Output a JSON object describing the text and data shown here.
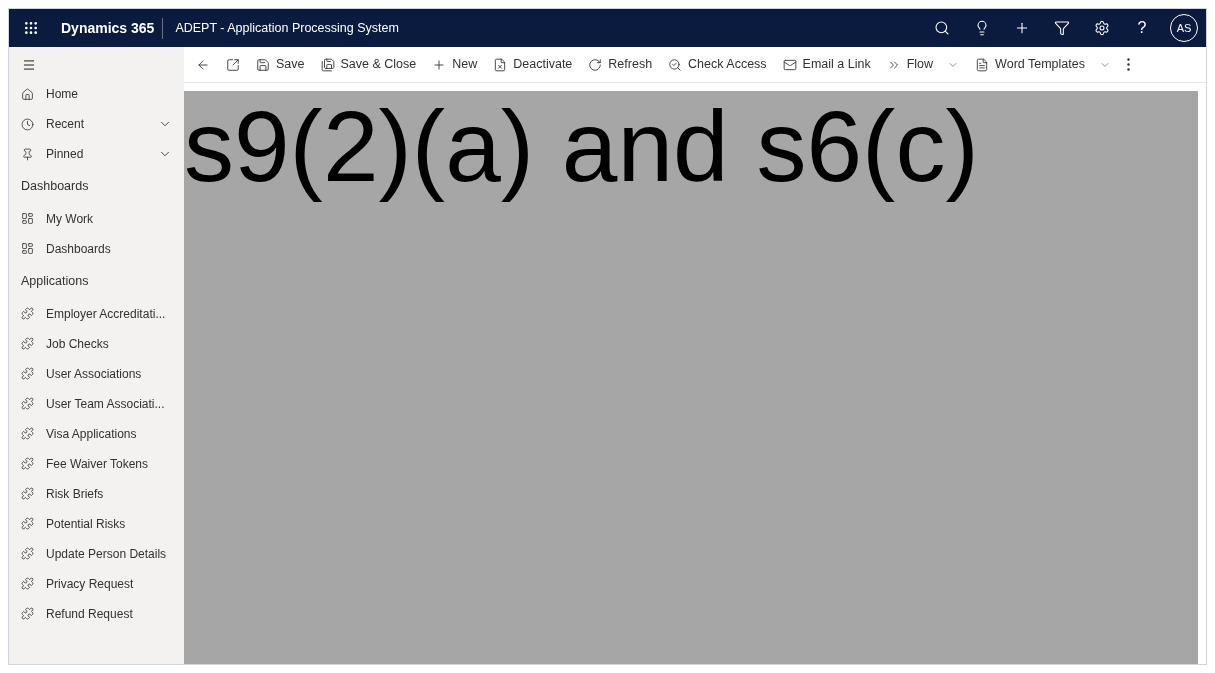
{
  "header": {
    "app_name": "Dynamics 365",
    "title": "ADEPT - Application Processing System",
    "help_glyph": "?",
    "user_initials": "AS"
  },
  "command_bar": [
    {
      "kind": "back"
    },
    {
      "kind": "popout"
    },
    {
      "kind": "save",
      "label": "Save",
      "dropdown": false
    },
    {
      "kind": "save_close",
      "label": "Save & Close",
      "dropdown": false
    },
    {
      "kind": "new",
      "label": "New",
      "dropdown": false
    },
    {
      "kind": "deactivate",
      "label": "Deactivate",
      "dropdown": false
    },
    {
      "kind": "refresh",
      "label": "Refresh",
      "dropdown": false
    },
    {
      "kind": "check_access",
      "label": "Check Access",
      "dropdown": false
    },
    {
      "kind": "email_link",
      "label": "Email a Link",
      "dropdown": false
    },
    {
      "kind": "flow",
      "label": "Flow",
      "dropdown": true
    },
    {
      "kind": "word_templates",
      "label": "Word Templates",
      "dropdown": true
    },
    {
      "kind": "more"
    }
  ],
  "sidebar": {
    "top_items": [
      {
        "kind": "home",
        "label": "Home"
      },
      {
        "kind": "recent",
        "label": "Recent",
        "expanded": false
      },
      {
        "kind": "pinned",
        "label": "Pinned",
        "expanded": false
      }
    ],
    "sections": [
      {
        "title": "Dashboards",
        "items": [
          {
            "kind": "dashboard",
            "label": "My Work"
          },
          {
            "kind": "dashboard",
            "label": "Dashboards"
          }
        ]
      },
      {
        "title": "Applications",
        "items": [
          {
            "kind": "entity",
            "label": "Employer Accreditati..."
          },
          {
            "kind": "entity",
            "label": "Job Checks"
          },
          {
            "kind": "entity",
            "label": "User Associations"
          },
          {
            "kind": "entity",
            "label": "User Team Associati..."
          },
          {
            "kind": "entity",
            "label": "Visa Applications"
          },
          {
            "kind": "entity",
            "label": "Fee Waiver Tokens"
          },
          {
            "kind": "entity",
            "label": "Risk Briefs"
          },
          {
            "kind": "entity",
            "label": "Potential Risks"
          },
          {
            "kind": "entity",
            "label": "Update Person Details"
          },
          {
            "kind": "entity",
            "label": "Privacy Request"
          },
          {
            "kind": "entity",
            "label": "Refund Request"
          }
        ]
      }
    ]
  },
  "redaction": {
    "text": "s9(2)(a) and s6(c)"
  }
}
